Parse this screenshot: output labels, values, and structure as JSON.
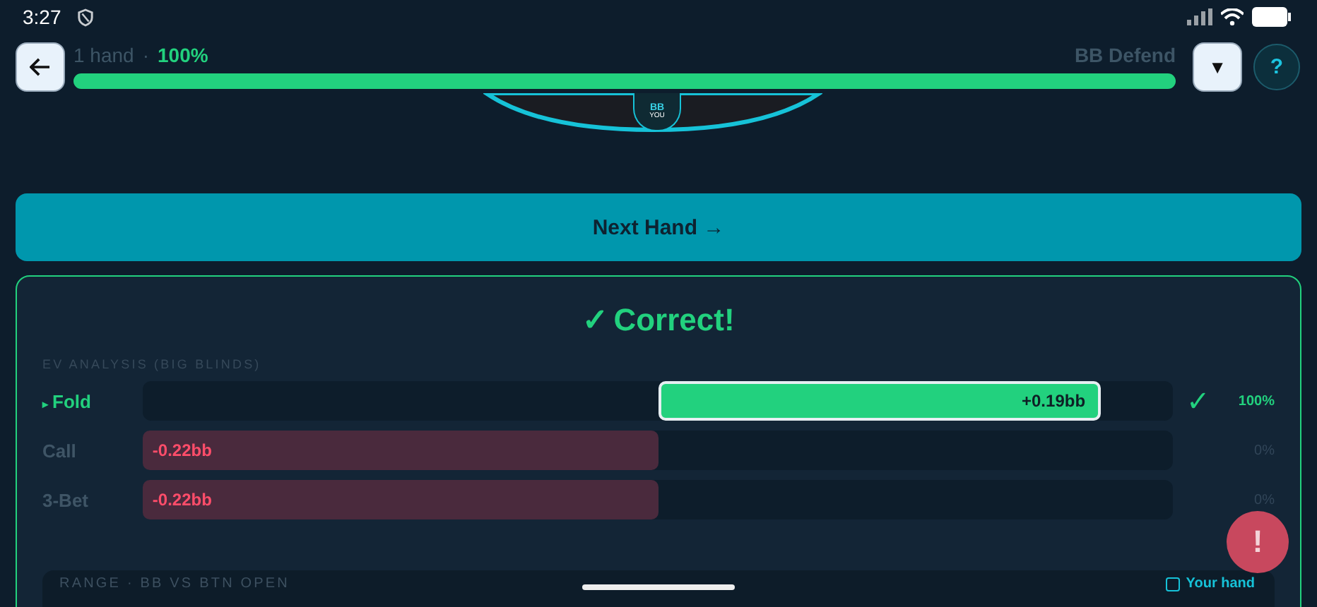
{
  "status_bar": {
    "time": "3:27"
  },
  "header": {
    "hands": "1 hand",
    "separator": "·",
    "accuracy": "100%",
    "progress": {
      "level": 1
    },
    "scenario": "BB Defend",
    "dropdown": "▼",
    "help": "?"
  },
  "table": {
    "seat": "BB",
    "seat_label": "YOU"
  },
  "next_button": "Next Hand →",
  "result": {
    "mark": "✓",
    "title": "Correct!",
    "section": "EV ANALYSIS (BIG BLINDS)",
    "actions": [
      {
        "name": "Fold",
        "selected": true,
        "kind": "positive",
        "level": 0.86,
        "ev": "+0.19bb",
        "correct": true,
        "frequency": "100%"
      },
      {
        "name": "Call",
        "selected": false,
        "kind": "negative",
        "level": 1,
        "ev": "-0.22bb",
        "correct": false,
        "frequency": "0%"
      },
      {
        "name": "3-Bet",
        "selected": false,
        "kind": "negative",
        "level": 1,
        "ev": "-0.22bb",
        "correct": false,
        "frequency": "0%"
      }
    ],
    "check": "✓",
    "marker": "▸"
  },
  "range": {
    "title": "RANGE · BB VS BTN OPEN",
    "legend": "Your hand"
  },
  "alert_button": "!"
}
